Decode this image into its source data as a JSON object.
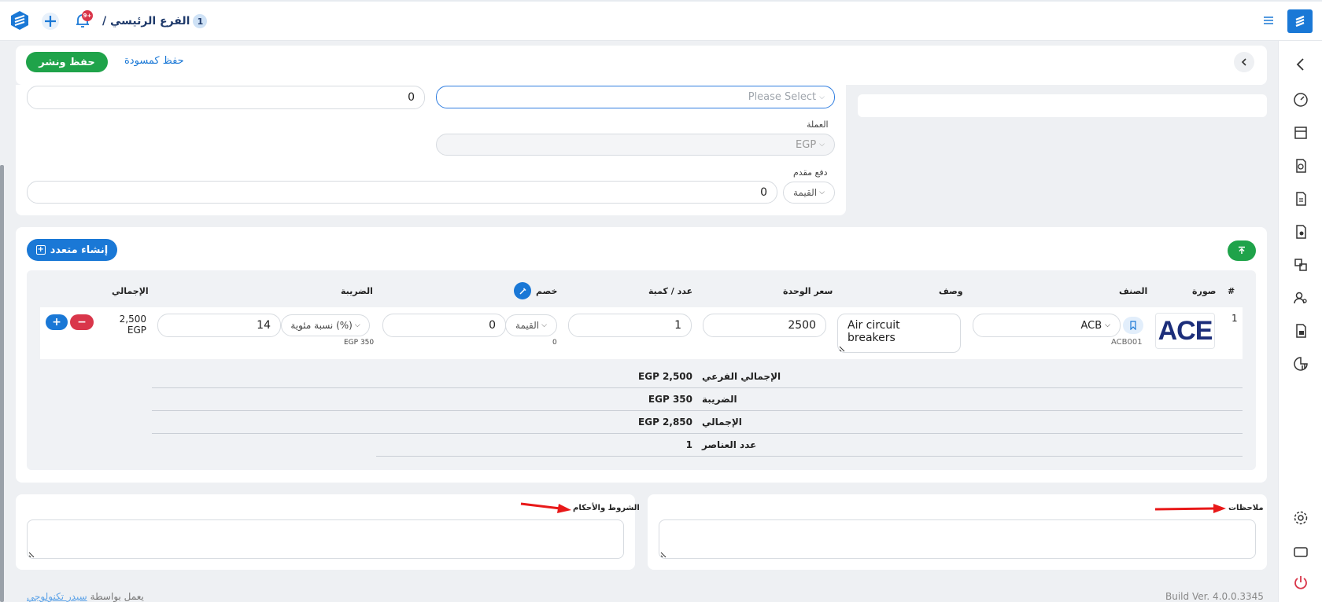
{
  "topbar": {
    "branch_number": "1",
    "branch_name": "الفرع الرئيسي /",
    "notification_count": "9+"
  },
  "actions": {
    "publish_label": "حفظ ونشر",
    "draft_label": "حفظ كمسودة"
  },
  "form": {
    "number_value": "0",
    "select_placeholder": "Please Select",
    "currency_label": "العملة",
    "currency_value": "EGP",
    "advance_label": "دفع مقدم",
    "advance_type": "القيمة",
    "advance_value": "0"
  },
  "items": {
    "bulk_create_label": "إنشاء متعدد",
    "headers": {
      "index": "#",
      "image": "صورة",
      "item": "الصنف",
      "description": "وصف",
      "unit_price": "سعر الوحدة",
      "quantity": "عدد / كمية",
      "discount": "خصم",
      "tax": "الضريبة",
      "total": "الإجمالي"
    },
    "rows": [
      {
        "index": "1",
        "logo_text": "ACE",
        "item_value": "ACB",
        "item_code": "ACB001",
        "description": "Air circuit breakers",
        "unit_price": "2500",
        "quantity": "1",
        "discount_type": "القيمة",
        "discount_value": "0",
        "discount_sub": "0",
        "tax_type": "نسبة مئوية (%)",
        "tax_value": "14",
        "tax_sub": "EGP 350",
        "total_amount": "2,500",
        "total_currency": "EGP"
      }
    ],
    "totals": [
      {
        "label": "الإجمالي الفرعي",
        "value": "EGP 2,500"
      },
      {
        "label": "الضريبة",
        "value": "EGP 350"
      },
      {
        "label": "الإجمالي",
        "value": "EGP 2,850"
      },
      {
        "label": "عدد العناصر",
        "value": "1"
      }
    ]
  },
  "notes": {
    "terms_label": "الشروط والأحكام",
    "notes_label": "ملاحظات"
  },
  "footer": {
    "powered_prefix": "يعمل بواسطة",
    "powered_company": "سيدر تكنولوجي",
    "build": "Build Ver. 4.0.0.3345"
  },
  "colors": {
    "brand_blue": "#1a78d6",
    "green": "#1fa34a",
    "red": "#d9364a",
    "annotation_red": "#e81919"
  }
}
